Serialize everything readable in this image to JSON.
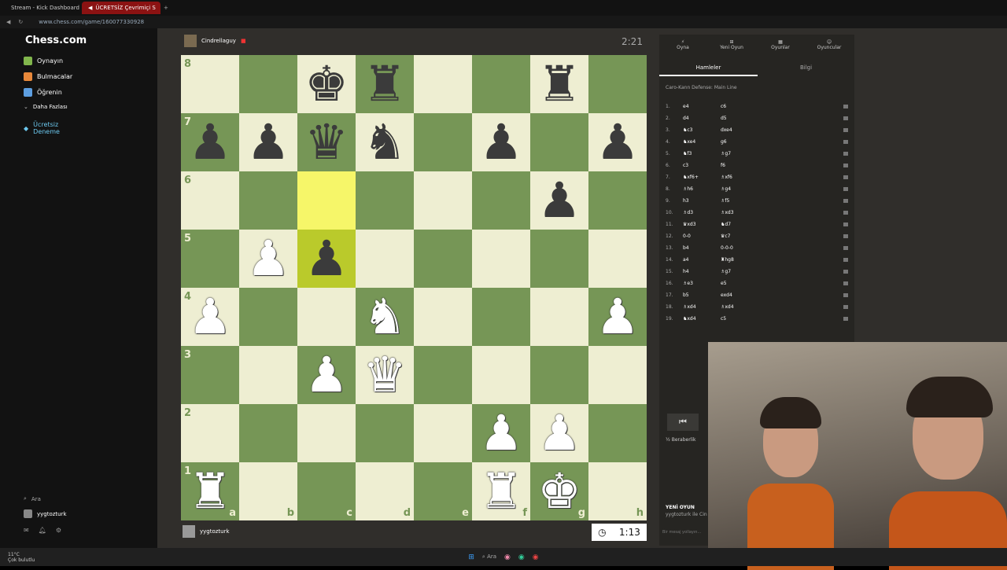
{
  "browser": {
    "tabs": [
      "Stream - Kick Dashboard",
      "ÜCRETSİZ Çevrimiçi S"
    ],
    "url": "www.chess.com/game/160077330928"
  },
  "sidebar": {
    "logo": "Chess.com",
    "items": [
      {
        "label": "Oynayın",
        "icon": "play-icon",
        "color": "#81b64c"
      },
      {
        "label": "Bulmacalar",
        "icon": "puzzle-icon",
        "color": "#e8883a"
      },
      {
        "label": "Öğrenin",
        "icon": "learn-icon",
        "color": "#5d9ee0"
      },
      {
        "label": "Daha Fazlası",
        "icon": "chevron-down-icon",
        "color": "#ccc"
      },
      {
        "label": "Ücretsiz Deneme",
        "icon": "diamond-icon",
        "color": "#6cc8ef"
      }
    ],
    "search": "Ara",
    "username": "yygtozturk"
  },
  "game": {
    "opponent": "Cindrellaguy",
    "opponent_clock": "2:21",
    "player": "yygtozturk",
    "player_clock": "1:13",
    "files": [
      "a",
      "b",
      "c",
      "d",
      "e",
      "f",
      "g",
      "h"
    ],
    "ranks": [
      "8",
      "7",
      "6",
      "5",
      "4",
      "3",
      "2",
      "1"
    ],
    "board_fen": "2kr2r1/ppqn1p1p/6p1/1Pp5/P2N3P/2PQ4/5PP1/R4RK1",
    "highlight_squares": [
      "c6",
      "c5"
    ]
  },
  "panel": {
    "tabs": [
      {
        "label": "Oyna",
        "icon": "play-icon"
      },
      {
        "label": "Yeni Oyun",
        "icon": "plus-icon"
      },
      {
        "label": "Oyunlar",
        "icon": "games-icon"
      },
      {
        "label": "Oyuncular",
        "icon": "players-icon"
      }
    ],
    "subtabs": [
      "Hamleler",
      "Bilgi"
    ],
    "opening": "Caro-Kann Defense: Main Line",
    "moves": [
      [
        "1.",
        "e4",
        "c6"
      ],
      [
        "2.",
        "d4",
        "d5"
      ],
      [
        "3.",
        "♞c3",
        "dxe4"
      ],
      [
        "4.",
        "♞xe4",
        "g6"
      ],
      [
        "5.",
        "♞f3",
        "♗g7"
      ],
      [
        "6.",
        "c3",
        "f6"
      ],
      [
        "7.",
        "♞xf6+",
        "♗xf6"
      ],
      [
        "8.",
        "♗h6",
        "♗g4"
      ],
      [
        "9.",
        "h3",
        "♗f5"
      ],
      [
        "10.",
        "♗d3",
        "♗xd3"
      ],
      [
        "11.",
        "♛xd3",
        "♞d7"
      ],
      [
        "12.",
        "0-0",
        "♛c7"
      ],
      [
        "13.",
        "b4",
        "0-0-0"
      ],
      [
        "14.",
        "a4",
        "♜hg8"
      ],
      [
        "15.",
        "h4",
        "♗g7"
      ],
      [
        "16.",
        "♗e3",
        "e5"
      ],
      [
        "17.",
        "b5",
        "exd4"
      ],
      [
        "18.",
        "♗xd4",
        "♗xd4"
      ],
      [
        "19.",
        "♞xd4",
        "c5"
      ]
    ],
    "draw_label": "Beraberlik",
    "new_game": "YENİ OYUN",
    "new_game_sub": "yygtozturk ile Cin",
    "chat_placeholder": "Bir mesaj yollayın..."
  },
  "taskbar": {
    "search": "Ara",
    "weather": "11°C",
    "weather_sub": "Çok bulutlu"
  }
}
